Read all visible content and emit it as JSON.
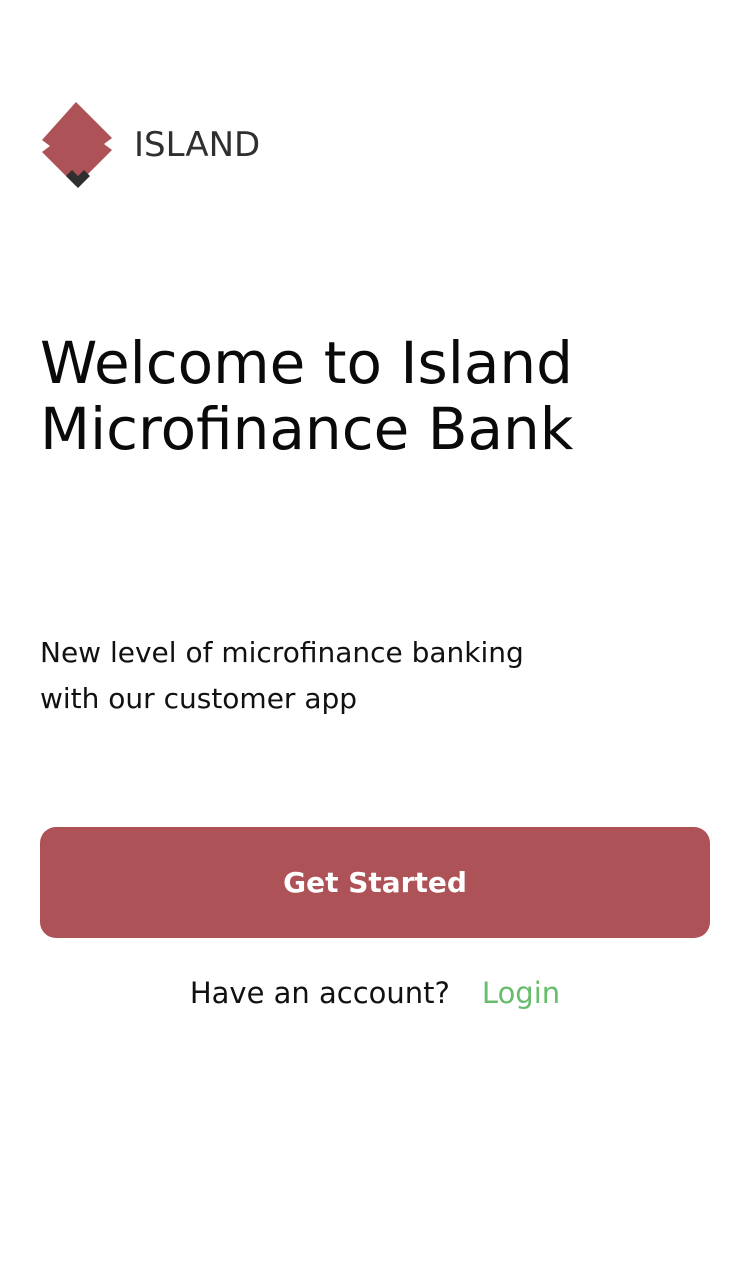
{
  "brand": {
    "name": "ISLAND",
    "logo_icon": "island-diamond-logo-icon",
    "logo_color": "#ad5357",
    "logo_accent_color": "#2f2f2f"
  },
  "welcome": {
    "headline_line1": "Welcome to Island",
    "headline_line2": "Microfinance Bank",
    "subtitle_line1": "New level of microfinance banking",
    "subtitle_line2": "with our customer app"
  },
  "actions": {
    "get_started_label": "Get Started",
    "account_prompt": "Have an account?",
    "login_label": "Login"
  },
  "colors": {
    "primary": "#ad5357",
    "link": "#67bd6b",
    "text": "#111111",
    "background": "#ffffff"
  }
}
